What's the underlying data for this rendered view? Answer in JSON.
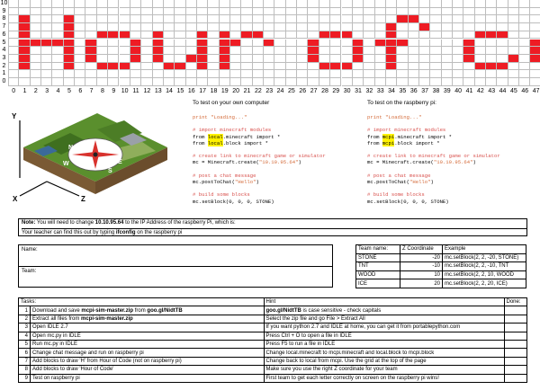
{
  "grid": {
    "columns": 48,
    "rows": 11,
    "row_labels": [
      "10",
      "9",
      "8",
      "7",
      "6",
      "5",
      "4",
      "3",
      "2",
      "1",
      "0"
    ],
    "column_labels": [
      "0",
      "1",
      "2",
      "3",
      "4",
      "5",
      "6",
      "7",
      "8",
      "9",
      "10",
      "11",
      "12",
      "13",
      "14",
      "15",
      "16",
      "17",
      "18",
      "19",
      "20",
      "21",
      "22",
      "23",
      "24",
      "25",
      "26",
      "27",
      "28",
      "29",
      "30",
      "31",
      "32",
      "33",
      "34",
      "35",
      "36",
      "37",
      "38",
      "39",
      "40",
      "41",
      "42",
      "43",
      "44",
      "45",
      "46",
      "47"
    ],
    "banner_text": "Hour of code",
    "fill_color": "#ee1c24"
  },
  "panels": {
    "own_title": "To test on your own computer",
    "pi_title": "To test on the raspberry pi:",
    "own_code": {
      "l1": "print \"Loading...\"",
      "l2": "# import minecraft modules",
      "l3a": "from ",
      "l3b": "local",
      "l3c": ".minecraft import *",
      "l4a": "from ",
      "l4b": "local",
      "l4c": ".block import *",
      "l5": "# create link to minecraft game or simulator",
      "l6a": "mc = Minecraft.create(",
      "l6b": "\"10.10.95.64\"",
      "l6c": ")",
      "l7": "# post a chat message",
      "l8a": "mc.postToChat(",
      "l8b": "\"Hello\"",
      "l8c": ")",
      "l9": "# build some blocks",
      "l10": "mc.setBlock(0, 0, 0, STONE)"
    },
    "pi_code": {
      "l1": "print \"Loading...\"",
      "l2": "# import minecraft modules",
      "l3a": "from ",
      "l3b": "mcpi",
      "l3c": ".minecraft import *",
      "l4a": "from ",
      "l4b": "mcpi",
      "l4c": ".block import *",
      "l5": "# create link to minecraft game or simulator",
      "l6a": "mc = Minecraft.create(",
      "l6b": "\"10.10.95.64\"",
      "l6c": ")",
      "l7": "# post a chat message",
      "l8a": "mc.postToChat(",
      "l8b": "\"Hello\"",
      "l8c": ")",
      "l9": "# build some blocks",
      "l10": "mc.setBlock(0, 0, 0, STONE)"
    }
  },
  "map_labels": {
    "y": "Y",
    "x": "X",
    "z": "Z",
    "n": "N",
    "e": "E",
    "s": "S",
    "w": "W"
  },
  "note": {
    "prefix": "Note:",
    "text1": " You will need to change ",
    "ip": "10.10.95.64",
    "text2": " to the IP Address of the raspberry Pi, which is:",
    "text3": "Your teacher can find this out by typing ",
    "cmd": "ifconfig",
    "text4": " on the raspberry pi"
  },
  "form": {
    "name_label": "Name:",
    "team_label": "Team:"
  },
  "coord_table": {
    "headers": [
      "Team name:",
      "Z Coordinate",
      "Example"
    ],
    "rows": [
      {
        "team": "STONE",
        "z": "-20",
        "example": "mc.setBlock(2, 2, -20, STONE)"
      },
      {
        "team": "TNT",
        "z": "-10",
        "example": "mc.setBlock(2, 2, -10, TNT"
      },
      {
        "team": "WOOD",
        "z": "10",
        "example": "mc.setBlock(2, 2, 10, WOOD"
      },
      {
        "team": "ICE",
        "z": "20",
        "example": "mc.setBlock(2, 2, 20, ICE)"
      }
    ]
  },
  "tasks": {
    "headers": [
      "Tasks:",
      "Hint",
      "Done:"
    ],
    "rows": [
      {
        "n": "1",
        "t_a": "Download and save ",
        "t_b": "mcpi-sim-master.zip",
        "t_c": " from ",
        "t_d": "goo.gl/NidtTB",
        "h_a": "goo.gl/NidtTB",
        "h_b": " is case sensitive - check capitals"
      },
      {
        "n": "2",
        "t_a": "Extract all files from ",
        "t_b": "mcpi-sim-master.zip",
        "t_c": "",
        "t_d": "",
        "h_a": "",
        "h_b": "Select the zip file and go File > Extract All"
      },
      {
        "n": "3",
        "t_a": "Open IDLE 2.7",
        "t_b": "",
        "t_c": "",
        "t_d": "",
        "h_a": "",
        "h_b": "If you want python 2.7 and IDLE at home, you can get it from portablepython.com"
      },
      {
        "n": "4",
        "t_a": "Open mc.py in IDLE",
        "t_b": "",
        "t_c": "",
        "t_d": "",
        "h_a": "",
        "h_b": "Press Ctrl + O to open a file in IDLE"
      },
      {
        "n": "5",
        "t_a": "Run mc.py in IDLE",
        "t_b": "",
        "t_c": "",
        "t_d": "",
        "h_a": "",
        "h_b": "Press F5 to run a file in IDLE"
      },
      {
        "n": "6",
        "t_a": "Change chat message and run on raspberry pi",
        "t_b": "",
        "t_c": "",
        "t_d": "",
        "h_a": "",
        "h_b": "Change local.minecraft to mcpi.minecraft and local.block to mcpi.block"
      },
      {
        "n": "7",
        "t_a": "Add blocks to draw 'H' from Hour of Code (not on raspberry pi)",
        "t_b": "",
        "t_c": "",
        "t_d": "",
        "h_a": "",
        "h_b": "Change back to local from mcpi. Use the grid at the top of the page"
      },
      {
        "n": "8",
        "t_a": "Add blocks to draw 'Hour of Code'",
        "t_b": "",
        "t_c": "",
        "t_d": "",
        "h_a": "",
        "h_b": "Make sure you use the right Z coordinate for your team"
      },
      {
        "n": "9",
        "t_a": "Test on raspberry pi",
        "t_b": "",
        "t_c": "",
        "t_d": "",
        "h_a": "",
        "h_b": "First team to get each letter correctly on screen on the raspberry pi wins!"
      }
    ]
  }
}
